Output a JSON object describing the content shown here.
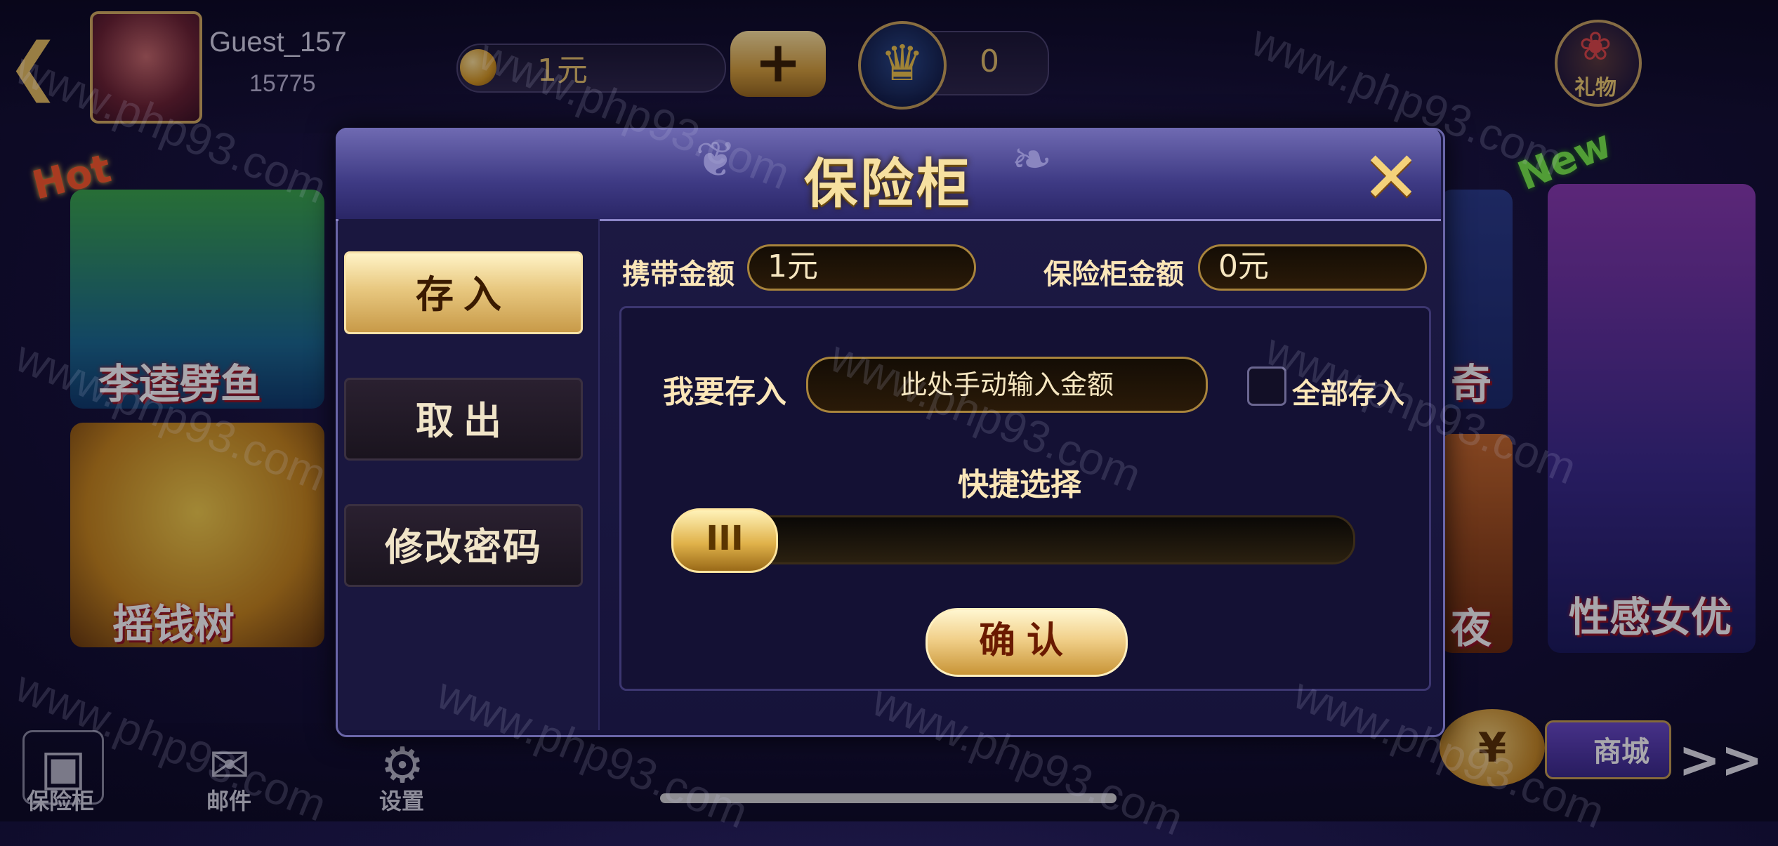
{
  "header": {
    "user_name": "Guest_157",
    "user_id": "15775",
    "coin_balance": "1元",
    "add_label": "+",
    "crown_count": "0",
    "gift_label": "礼物"
  },
  "games": {
    "hot_badge": "Hot",
    "new_badge": "New",
    "card1_title": "李逵劈鱼",
    "card2_title": "摇钱树",
    "card3_title": "奇",
    "card4_title": "夜",
    "card5_title": "性感女优"
  },
  "bottom": {
    "safe_label": "保险柜",
    "mail_label": "邮件",
    "settings_label": "设置",
    "shop_label": "商城",
    "more_label": ">>"
  },
  "modal": {
    "title": "保险柜",
    "tabs": [
      {
        "label": "存入",
        "active": true
      },
      {
        "label": "取出",
        "active": false
      },
      {
        "label": "修改密码",
        "active": false
      }
    ],
    "carry_label": "携带金额",
    "carry_value": "1元",
    "safe_label": "保险柜金额",
    "safe_value": "0元",
    "deposit_label": "我要存入",
    "deposit_placeholder": "此处手动输入金额",
    "deposit_all_label": "全部存入",
    "quick_select_label": "快捷选择",
    "slider_thumb_label": "III",
    "slider_value": 0,
    "confirm_label": "确认"
  },
  "watermark": "www.php93.com",
  "colors": {
    "gold": "#f1d08a",
    "modal_bg": "#1d1a44",
    "header_bg": "#3e3a84"
  }
}
